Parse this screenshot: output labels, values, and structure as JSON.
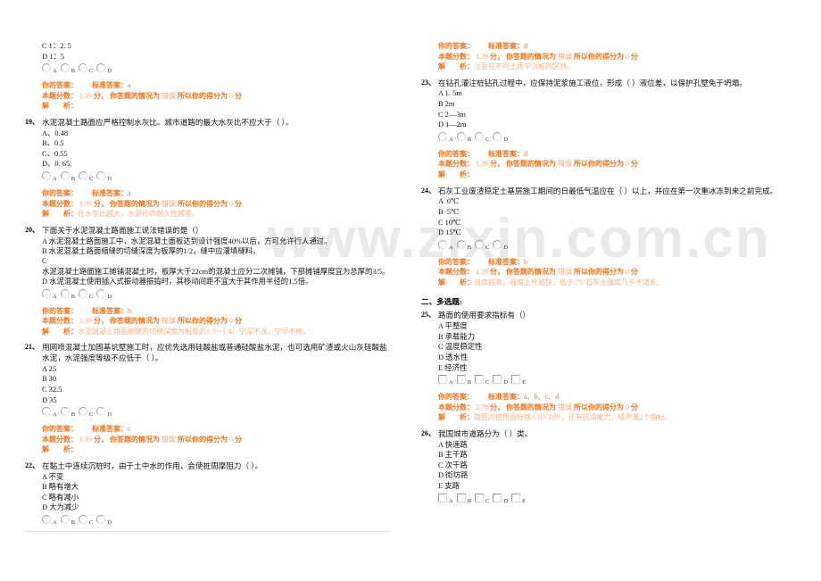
{
  "watermark": {
    "text_1": "www.zixin.com.cn",
    "text_2": "zixin.com.cn"
  },
  "labels": {
    "your_answer": "你的答案：",
    "standard_answer": "标准答案：",
    "score_label": "本题分数：",
    "score_unit": "分，",
    "result_prefix": "你答题的情况为",
    "result_suffix": "所以你的得分为",
    "point_unit": "分",
    "analysis_label": "解　　析：",
    "option_a": "A",
    "option_b": "B",
    "option_c": "C",
    "option_d": "D",
    "option_e": "E"
  },
  "left_column": {
    "questions": [
      {
        "number": "",
        "stem": "",
        "options": [
          "C 1：2. 5",
          "D 1：5"
        ],
        "control": "radio",
        "controls": [
          "A",
          "B",
          "C",
          "D"
        ],
        "your_answer": "",
        "standard_answer": "a",
        "score": "1.39",
        "result": "错误",
        "earned": "0",
        "analysis": ""
      },
      {
        "number": "19、",
        "stem": "水泥混凝土路面应严格控制水灰比。城市道路的最大水灰比不应大于（      ）。",
        "options": [
          "A、0.48",
          "B、0.5",
          "C、0.55",
          "D、0. 65."
        ],
        "control": "radio",
        "controls": [
          "A",
          "B",
          "C",
          "D"
        ],
        "your_answer": "",
        "standard_answer": "a",
        "score": "1.39",
        "result": "错误",
        "earned": "0",
        "analysis": "砼水灰比越大，水泥砼的耐久性越差。"
      },
      {
        "number": "20、",
        "stem": "下面关于水泥混凝土路面施工说法错误的是（）",
        "options": [
          "A 水泥混凝土路面施工中，水泥混凝土面板达到设计强度40%以后，方可允许行人通过。",
          "B 水泥混凝土路面缩缝的切缝深度为板厚的1/2，缝中应灌填缝料。",
          "C",
          "水泥混凝土路面施工摊铺混凝土时，板厚大于22cm的混凝土应分二次摊铺，下部摊铺厚度宜为总厚的3/5。",
          "D 水泥混凝土使用插入式振动器振捣时，其移动间距不宜大于其作用半径的1.5倍。"
        ],
        "control": "radio",
        "controls": [
          "A",
          "B",
          "C",
          "D"
        ],
        "your_answer": "",
        "standard_answer": "b",
        "score": "1.39",
        "result": "错误",
        "earned": "0",
        "analysis": "水泥混凝土路面缩缝的切缝深度为板厚的1/3～1/4。宁深不浅。宁早不晚。"
      },
      {
        "number": "21、",
        "stem": "用网喷混凝土加固基坑壁施工时，应优先选用硅酸盐或普通硅酸盐水泥，也可选用矿渣或火山灰硅酸盐水泥，水泥强度等级不应低于（      ）。",
        "options": [
          "A 25",
          "B 30",
          "C 32.5",
          "D 35"
        ],
        "control": "radio",
        "controls": [
          "A",
          "B",
          "C",
          "D"
        ],
        "your_answer": "",
        "standard_answer": "c",
        "score": "1.39",
        "result": "错误",
        "earned": "0",
        "analysis": ""
      },
      {
        "number": "22、",
        "stem": "在黏土中连续沉桩时，由于土中水的作用，会使桩周摩阻力（      ）。",
        "options": [
          "A 不变",
          "B 略有增大",
          "C 略有减小",
          "D 大为减少"
        ],
        "control": "radio",
        "controls": [
          "A",
          "B",
          "C",
          "D"
        ],
        "your_answer": "",
        "standard_answer": "",
        "score": "",
        "result": "",
        "earned": "",
        "analysis": ""
      }
    ]
  },
  "right_column": {
    "top_answer": {
      "your_answer": "",
      "standard_answer": "d",
      "score": "1.39",
      "result": "错误",
      "earned": "0",
      "analysis": "注意在不同土质中沉桩的区别。"
    },
    "questions": [
      {
        "number": "23、",
        "stem": "在钻孔灌注桩钻孔过程中，应保持泥浆施工液位，形成（      ）液位差，以保护孔壁免于坍塌。",
        "options": [
          "A 1. 5m",
          "B 2m",
          "C 2—3m",
          "D 1—2m"
        ],
        "control": "radio",
        "controls": [
          "A",
          "B",
          "C",
          "D"
        ],
        "your_answer": "",
        "standard_answer": "d",
        "score": "1.39",
        "result": "错误",
        "earned": "0",
        "analysis": ""
      },
      {
        "number": "24、",
        "stem": "石灰工业废渣稳定土基层施工期间的日最低气温应在（      ）以上，并应在第一次重冰冻到来之前完成。",
        "options": [
          "A  0℃",
          "B  5℃",
          "C 10℃",
          "D 15℃"
        ],
        "control": "radio",
        "controls": [
          "A",
          "B",
          "C",
          "D"
        ],
        "your_answer": "",
        "standard_answer": "b",
        "score": "1.39",
        "result": "错误",
        "earned": "0",
        "analysis": "温度越高，强度上升越快，低于5℃石灰土强度几乎不增长。"
      }
    ],
    "section_title": "二、多选题:",
    "multi_questions": [
      {
        "number": "25、",
        "stem": "路面的使用要求指标有（）",
        "options": [
          "A 平整度",
          "B 承载能力",
          "C 温度稳定性",
          "D 透水性",
          "E 经济性"
        ],
        "control": "checkbox",
        "controls": [
          "A",
          "B",
          "C",
          "D",
          "E"
        ],
        "your_answer": "",
        "standard_answer": "a、b、c、d",
        "score": "2.78",
        "result": "错误",
        "earned": "0",
        "analysis": "路面的使用指标除A B CD外，还有抗滑能力、噪声量2个指标。"
      },
      {
        "number": "26、",
        "stem": "我国城市道路分为（      ）类。",
        "options": [
          "A 快速路",
          "B 主干路",
          "C 次干路",
          "D 街坊路",
          "E 支路"
        ],
        "control": "checkbox",
        "controls": [
          "A",
          "B",
          "C",
          "D",
          "E"
        ],
        "your_answer": "",
        "standard_answer": "",
        "score": "",
        "result": "",
        "earned": "",
        "analysis": ""
      }
    ]
  },
  "colors": {
    "accent_orange": "#f0731a",
    "accent_orange_light": "#f7b183",
    "text": "#111111"
  }
}
